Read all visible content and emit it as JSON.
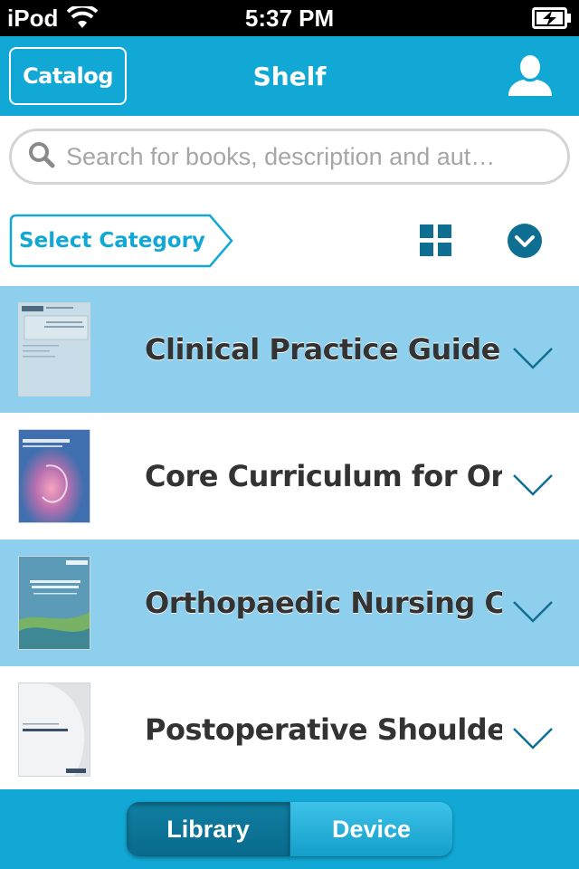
{
  "status_bar": {
    "carrier": "iPod",
    "time": "5:37 PM",
    "wifi_icon": "wifi-icon",
    "battery_icon": "battery-charging-icon"
  },
  "nav": {
    "catalog_label": "Catalog",
    "title": "Shelf",
    "profile_icon": "user-profile-icon"
  },
  "search": {
    "placeholder": "Search for books, description and aut…",
    "value": ""
  },
  "toolbar": {
    "category_label": "Select Category",
    "grid_icon": "grid-view-icon",
    "sort_icon": "chevron-down-circle-icon"
  },
  "books": [
    {
      "title": "Clinical Practice Guideli…",
      "highlighted": true
    },
    {
      "title": "Core Curriculum for Ort…",
      "highlighted": false
    },
    {
      "title": "Orthopaedic Nursing Co…",
      "highlighted": true
    },
    {
      "title": "Postoperative Shoulder…",
      "highlighted": false
    }
  ],
  "tabs": {
    "library_label": "Library",
    "device_label": "Device",
    "selected": "Library"
  },
  "colors": {
    "brand": "#12a8d5",
    "row_highlight": "#8fcfee",
    "icon_dark": "#0e6f92"
  }
}
